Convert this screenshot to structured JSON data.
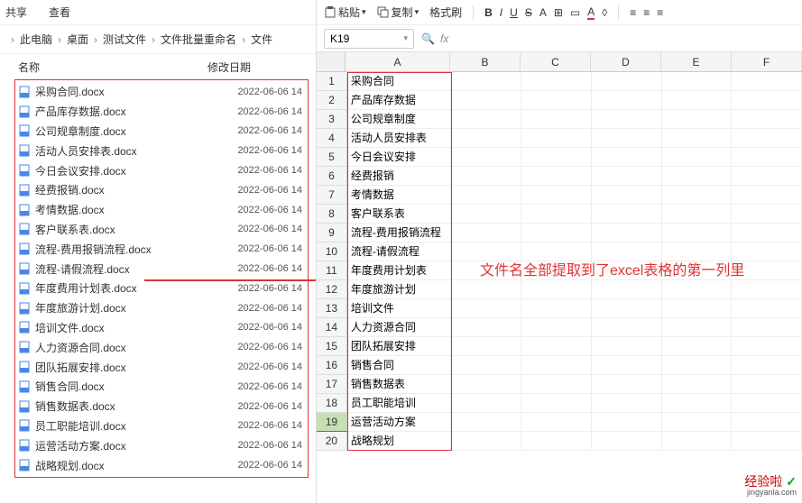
{
  "explorer": {
    "tabs": [
      "共享",
      "查看"
    ],
    "breadcrumb": [
      "此电脑",
      "桌面",
      "测试文件",
      "文件批量重命名",
      "文件"
    ],
    "columns": {
      "name": "名称",
      "date": "修改日期"
    },
    "date_value": "2022-06-06 14",
    "files": [
      "采购合同.docx",
      "产品库存数据.docx",
      "公司规章制度.docx",
      "活动人员安排表.docx",
      "今日会议安排.docx",
      "经费报销.docx",
      "考情数据.docx",
      "客户联系表.docx",
      "流程-费用报销流程.docx",
      "流程-请假流程.docx",
      "年度费用计划表.docx",
      "年度旅游计划.docx",
      "培训文件.docx",
      "人力资源合同.docx",
      "团队拓展安排.docx",
      "销售合同.docx",
      "销售数据表.docx",
      "员工职能培训.docx",
      "运营活动方案.docx",
      "战略规划.docx"
    ]
  },
  "excel": {
    "toolbar": {
      "paste": "粘贴",
      "copy": "复制",
      "format_painter": "格式刷"
    },
    "cell_ref": "K19",
    "fx_label": "fx",
    "columns": [
      "A",
      "B",
      "C",
      "D",
      "E",
      "F"
    ],
    "selected_row": 19,
    "cells_A": [
      "采购合同",
      "产品库存数据",
      "公司规章制度",
      "活动人员安排表",
      "今日会议安排",
      "经费报销",
      "考情数据",
      "客户联系表",
      "流程-费用报销流程",
      "流程-请假流程",
      "年度费用计划表",
      "年度旅游计划",
      "培训文件",
      "人力资源合同",
      "团队拓展安排",
      "销售合同",
      "销售数据表",
      "员工职能培训",
      "运营活动方案",
      "战略规划"
    ]
  },
  "annotation": "文件名全部提取到了excel表格的第一列里",
  "watermark": {
    "brand": "经验啦",
    "check": "✓",
    "domain": "jingyanla.com"
  }
}
